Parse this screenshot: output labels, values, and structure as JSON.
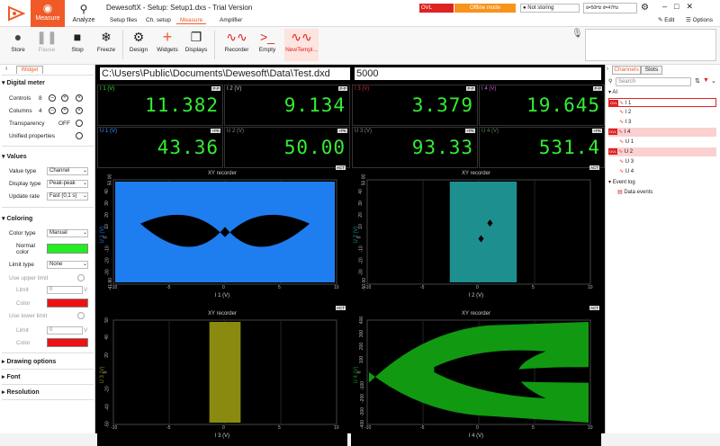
{
  "titlebar": {
    "app_name": "DewesoftX - Setup: Setup1.dxs - Trial Version",
    "tab_measure": "Measure",
    "tab_analyze": "Analyze",
    "subtabs": [
      "Setup files",
      "Ch. setup",
      "Measure",
      "Amplifier"
    ],
    "ovl_label": "OVL",
    "offline_label": "Offline mode",
    "store_status": "Not storing",
    "freq_text": "ä=50Hz d=47Hz",
    "edit_label": "Edit",
    "options_label": "Options"
  },
  "toolbar": {
    "buttons": [
      {
        "label": "Store"
      },
      {
        "label": "Pause"
      },
      {
        "label": "Stop"
      },
      {
        "label": "Freeze"
      },
      {
        "label": "Design"
      },
      {
        "label": "Widgets"
      },
      {
        "label": "Displays"
      },
      {
        "label": "Recorder"
      },
      {
        "label": "Empty"
      },
      {
        "label": "NewTempl..."
      }
    ]
  },
  "left_panel": {
    "tab": "Widget",
    "sections": {
      "digital_meter": "Digital meter",
      "values": "Values",
      "coloring": "Coloring",
      "drawing_options": "Drawing options",
      "font": "Font",
      "resolution": "Resolution"
    },
    "controls_label": "Controls",
    "controls_value": "8",
    "columns_label": "Columns",
    "columns_value": "4",
    "transparency_label": "Transparency",
    "transparency_value": "OFF",
    "unified_label": "Unified properties",
    "value_type_label": "Value type",
    "value_type": "Channel",
    "display_type_label": "Display type",
    "display_type": "Peak-peak",
    "update_rate_label": "Update rate",
    "update_rate": "Fast (0,1 s)",
    "color_type_label": "Color type",
    "color_type": "Manual",
    "normal_color_label": "Normal color",
    "normal_color": "#22ee22",
    "limit_type_label": "Limit type",
    "limit_type": "None",
    "use_upper_label": "Use upper limit",
    "use_lower_label": "Use lower limit",
    "limit_label": "Limit",
    "limit_value": "0",
    "limit_unit": "V",
    "color_label": "Color",
    "limit_color": "#ee1111"
  },
  "main": {
    "file_path": "C:\\Users\\Public\\Documents\\Dewesoft\\Data\\Test.dxd",
    "sample_count": "5000",
    "meters": [
      {
        "label": "I 1 (V)",
        "tag": "P-P",
        "value": "11.382",
        "color": "#33ee33"
      },
      {
        "label": "I 2 (V)",
        "tag": "P-P",
        "value": "9.134",
        "color": "#cccccc"
      },
      {
        "label": "I 3 (V)",
        "tag": "P-P",
        "value": "3.379",
        "color": "#cc3333"
      },
      {
        "label": "I 4 (V)",
        "tag": "P-P",
        "value": "19.645",
        "color": "#cc66cc"
      },
      {
        "label": "U 1 (V)",
        "tag": "+PK",
        "value": "43.36",
        "color": "#3399ff"
      },
      {
        "label": "U 2 (V)",
        "tag": "+PK",
        "value": "50.00",
        "color": "#888888"
      },
      {
        "label": "U 3 (V)",
        "tag": "+PK",
        "value": "93.33",
        "color": "#888888"
      },
      {
        "label": "U 4 (V)",
        "tag": "+PK",
        "value": "531.4",
        "color": "#558855"
      }
    ],
    "plots": [
      {
        "title": "XY recorder",
        "act": "ACT",
        "xlabel": "I 1 (V)",
        "ylabel": "U 1 (V)",
        "color": "#1e7ef0",
        "yticks": [
          "50.00",
          "40",
          "30",
          "20",
          "10",
          "0",
          "-10",
          "-20",
          "-30",
          "-41.80"
        ],
        "xticks": [
          "-10",
          "-5",
          "0",
          "5",
          "10"
        ]
      },
      {
        "title": "XY recorder",
        "act": "ACT",
        "xlabel": "I 2 (V)",
        "ylabel": "U 2 (V)",
        "color": "#1e8f8f",
        "yticks": [
          "50.00",
          "40",
          "30",
          "20",
          "10",
          "0",
          "-10",
          "-20",
          "-30",
          "-50.00"
        ],
        "xticks": [
          "-10",
          "-5",
          "0",
          "5",
          "10"
        ]
      },
      {
        "title": "XY recorder",
        "act": "ACT",
        "xlabel": "I 3 (V)",
        "ylabel": "U 3 (V)",
        "color": "#8a8a10",
        "yticks": [
          "50",
          "40",
          "20",
          "0",
          "-20",
          "-40",
          "-50"
        ],
        "xticks": [
          "-10",
          "-5",
          "0",
          "5",
          "10"
        ]
      },
      {
        "title": "XY recorder",
        "act": "ACT",
        "xlabel": "I 4 (V)",
        "ylabel": "U 4 (V)",
        "color": "#119911",
        "yticks": [
          "400",
          "300",
          "200",
          "100",
          "0",
          "-100",
          "-200",
          "-300",
          "-400"
        ],
        "xticks": [
          "-10",
          "-5",
          "0",
          "5",
          "10"
        ]
      }
    ]
  },
  "right_panel": {
    "tabs": [
      "Channels",
      "Slots"
    ],
    "search_placeholder": "Search",
    "group_ai": "AI",
    "channels": [
      {
        "name": "I 1",
        "ovl": true
      },
      {
        "name": "I 2",
        "ovl": false
      },
      {
        "name": "I 3",
        "ovl": false
      },
      {
        "name": "I 4",
        "ovl": true
      },
      {
        "name": "U 1",
        "ovl": false
      },
      {
        "name": "U 2",
        "ovl": true
      },
      {
        "name": "U 3",
        "ovl": false
      },
      {
        "name": "U 4",
        "ovl": false
      }
    ],
    "event_log": "Event log",
    "data_events": "Data events"
  }
}
